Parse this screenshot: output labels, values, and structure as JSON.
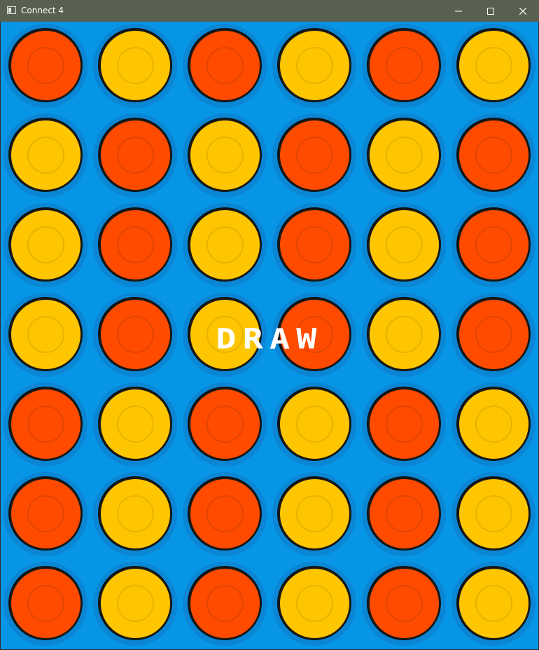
{
  "window": {
    "title": "Connect 4",
    "buttons": [
      "minimize",
      "maximize",
      "close"
    ]
  },
  "game": {
    "status_text": "DRAW",
    "columns": 6,
    "rows": 7,
    "colors": {
      "board": "#0795e6",
      "hole": "#0a86d4",
      "red": "#fe4b00",
      "yellow": "#fdc600"
    },
    "board": [
      [
        "red",
        "yellow",
        "red",
        "yellow",
        "red",
        "yellow"
      ],
      [
        "yellow",
        "red",
        "yellow",
        "red",
        "yellow",
        "red"
      ],
      [
        "yellow",
        "red",
        "yellow",
        "red",
        "yellow",
        "red"
      ],
      [
        "yellow",
        "red",
        "yellow",
        "red",
        "yellow",
        "red"
      ],
      [
        "red",
        "yellow",
        "red",
        "yellow",
        "red",
        "yellow"
      ],
      [
        "red",
        "yellow",
        "red",
        "yellow",
        "red",
        "yellow"
      ],
      [
        "red",
        "yellow",
        "red",
        "yellow",
        "red",
        "yellow"
      ]
    ]
  }
}
